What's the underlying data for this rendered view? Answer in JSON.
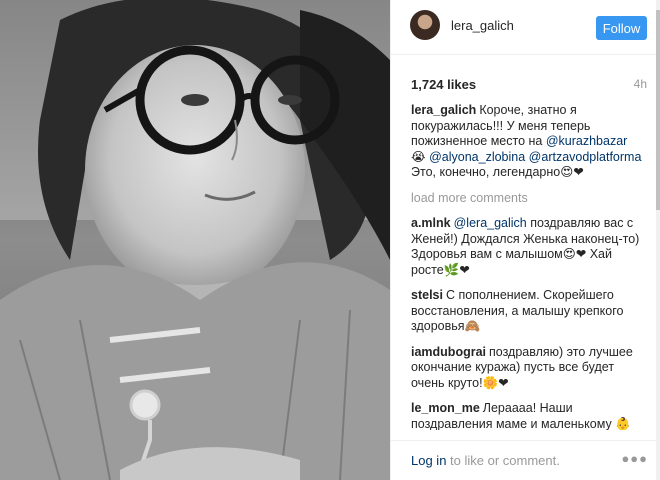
{
  "post": {
    "username": "lera_galich",
    "follow_label": "Follow",
    "likes": "1,724 likes",
    "time": "4h",
    "load_more": "load more comments",
    "login_link": "Log in",
    "login_text": " to like or comment.",
    "more_icon": "more-options-icon",
    "photo_icon": "photo-content-icon"
  },
  "caption": {
    "author": "lera_galich",
    "line1": "Короче, знатно я покуражилась!!! У меня теперь пожизненное место на ",
    "mention1": "@kurazhbazar",
    "mid": " 😭 ",
    "mention2": "@alyona_zlobina",
    "space": " ",
    "mention3": "@artzavodplatforma",
    "end": " Это, конечно, легендарно😍❤"
  },
  "comments": [
    {
      "author": "a.mlnk",
      "mention": "@lera_galich",
      "text": " поздравляю вас с Женей!) Дождался Женька наконец-то) Здоровья вам с малышом😍❤ Хай росте🌿❤"
    },
    {
      "author": "stelsi",
      "mention": "",
      "text": "С пополнением. Скорейшего восстановления, а малышу крепкого здоровья🙈"
    },
    {
      "author": "iamdubograi",
      "mention": "",
      "text": "поздравляю) это лучшее окончание куража) пусть все будет очень круто!🌼❤"
    },
    {
      "author": "le_mon_me",
      "mention": "",
      "text": "Лераааа! Наши поздравления маме и маленькому 👶 ❤"
    }
  ],
  "colors": {
    "follow_bg": "#3897f0",
    "mention": "#003569",
    "muted": "#999999"
  }
}
